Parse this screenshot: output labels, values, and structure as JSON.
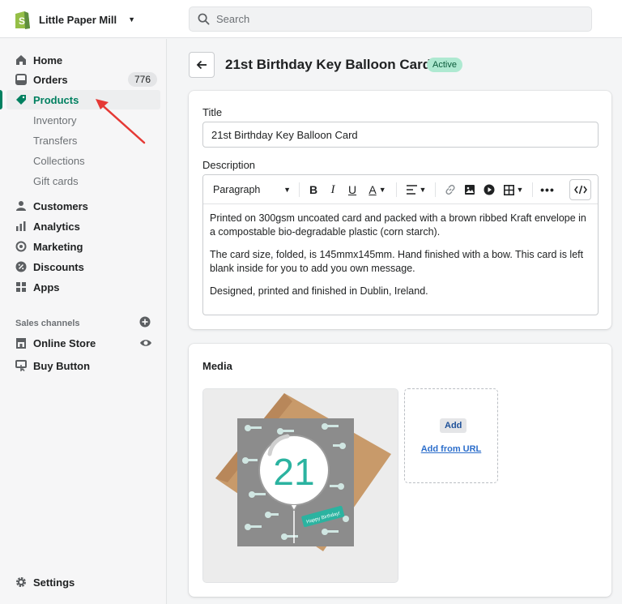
{
  "topbar": {
    "store_name": "Little Paper Mill",
    "search_placeholder": "Search"
  },
  "sidebar": {
    "items": [
      {
        "label": "Home",
        "icon": "home-icon"
      },
      {
        "label": "Orders",
        "icon": "orders-icon",
        "badge": "776"
      },
      {
        "label": "Products",
        "icon": "tag-icon",
        "active": true
      },
      {
        "label": "Customers",
        "icon": "person-icon"
      },
      {
        "label": "Analytics",
        "icon": "analytics-icon"
      },
      {
        "label": "Marketing",
        "icon": "marketing-icon"
      },
      {
        "label": "Discounts",
        "icon": "discount-icon"
      },
      {
        "label": "Apps",
        "icon": "apps-icon"
      }
    ],
    "sub_items": [
      "Inventory",
      "Transfers",
      "Collections",
      "Gift cards"
    ],
    "sales_channels_title": "Sales channels",
    "channels": [
      {
        "label": "Online Store",
        "icon": "store-icon"
      },
      {
        "label": "Buy Button",
        "icon": "buy-button-icon"
      }
    ],
    "settings_label": "Settings"
  },
  "page": {
    "title": "21st Birthday Key Balloon Card",
    "status": "Active"
  },
  "form": {
    "title_label": "Title",
    "title_value": "21st Birthday Key Balloon Card",
    "description_label": "Description",
    "toolbar": {
      "paragraph": "Paragraph",
      "bold": "B",
      "italic": "I",
      "underline": "U",
      "color": "A"
    },
    "description": [
      "Printed on 300gsm uncoated card and packed with a brown ribbed Kraft envelope in a compostable bio-degradable plastic (corn starch).",
      "The card size, folded, is 145mmx145mm. Hand finished with a bow. This card is left blank inside for you to add you own message.",
      "Designed, printed and finished in Dublin, Ireland."
    ]
  },
  "media": {
    "title": "Media",
    "card_number": "21",
    "card_tag": "Happy Birthday!",
    "add_label": "Add",
    "add_url_label": "Add from URL"
  },
  "colors": {
    "accent": "#008060",
    "arrow": "#e53935",
    "status_bg": "#aee9d1",
    "card_teal": "#2bb3a0"
  }
}
